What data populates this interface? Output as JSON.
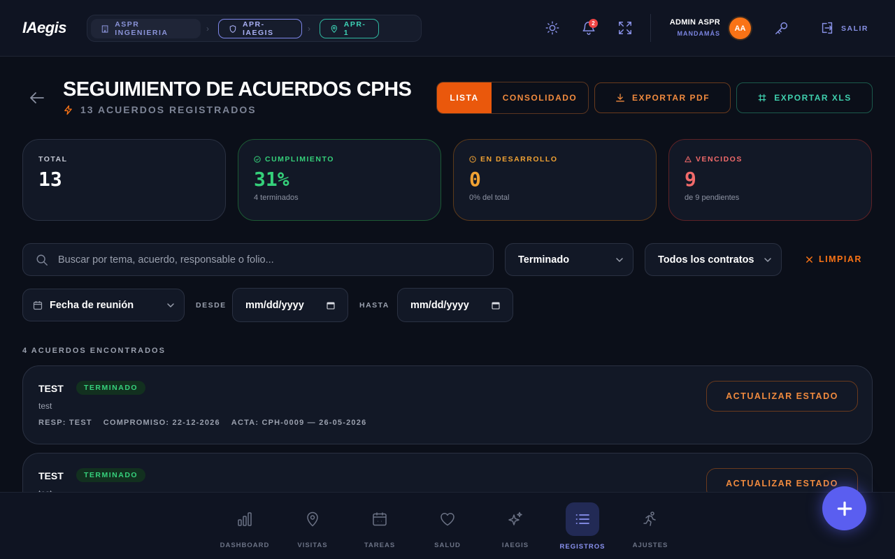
{
  "app": {
    "logo": "IAegis"
  },
  "breadcrumb": {
    "items": [
      {
        "label": "ASPR INGENIERIA",
        "icon": "building-icon"
      },
      {
        "label": "APR-IAEGIS",
        "icon": "shield-icon"
      },
      {
        "label": "APR-1",
        "icon": "location-pin-icon"
      }
    ]
  },
  "topbar": {
    "notification_count": "2",
    "user_name": "ADMIN ASPR",
    "user_role": "MANDAMÁS",
    "avatar_initials": "AA",
    "logout_label": "SALIR"
  },
  "header": {
    "title": "SEGUIMIENTO DE ACUERDOS CPHS",
    "subtitle": "13 ACUERDOS REGISTRADOS",
    "view_list": "LISTA",
    "view_consolidated": "CONSOLIDADO",
    "export_pdf": "EXPORTAR PDF",
    "export_xls": "EXPORTAR XLS"
  },
  "stats": {
    "total": {
      "label": "TOTAL",
      "value": "13"
    },
    "cumplimiento": {
      "label": "CUMPLIMIENTO",
      "value": "31%",
      "hint": "4 terminados"
    },
    "desarrollo": {
      "label": "EN DESARROLLO",
      "value": "0",
      "hint": "0% del total"
    },
    "vencidos": {
      "label": "VENCIDOS",
      "value": "9",
      "hint": "de 9 pendientes"
    }
  },
  "filters": {
    "search_placeholder": "Buscar por tema, acuerdo, responsable o folio...",
    "estado": "Terminado",
    "contratos": "Todos los contratos",
    "clear": "LIMPIAR",
    "date_field": "Fecha de reunión",
    "from_label": "DESDE",
    "to_label": "HASTA",
    "from_value": "mm/dd/yyyy",
    "to_value": "mm/dd/yyyy"
  },
  "results": {
    "count_label": "4 ACUERDOS ENCONTRADOS",
    "items": [
      {
        "title": "TEST",
        "status": "TERMINADO",
        "description": "test",
        "resp": "RESP: TEST",
        "compromiso": "COMPROMISO: 22-12-2026",
        "acta": "ACTA: CPH-0009 — 26-05-2026",
        "action": "ACTUALIZAR ESTADO"
      },
      {
        "title": "TEST",
        "status": "TERMINADO",
        "description": "test",
        "action": "ACTUALIZAR ESTADO"
      }
    ]
  },
  "bottom_nav": [
    {
      "label": "DASHBOARD",
      "icon": "bar-chart-icon"
    },
    {
      "label": "VISITAS",
      "icon": "location-pin-icon"
    },
    {
      "label": "TAREAS",
      "icon": "calendar-icon"
    },
    {
      "label": "SALUD",
      "icon": "heart-icon"
    },
    {
      "label": "IAEGIS",
      "icon": "sparkles-icon"
    },
    {
      "label": "REGISTROS",
      "icon": "list-icon",
      "active": true
    },
    {
      "label": "AJUSTES",
      "icon": "running-person-icon"
    }
  ],
  "colors": {
    "accent_orange": "#ea580c",
    "accent_indigo": "#5a5ef0",
    "success": "#35d07a",
    "warning": "#f0a233",
    "danger": "#f16a6a",
    "teal": "#3dd3b6"
  }
}
